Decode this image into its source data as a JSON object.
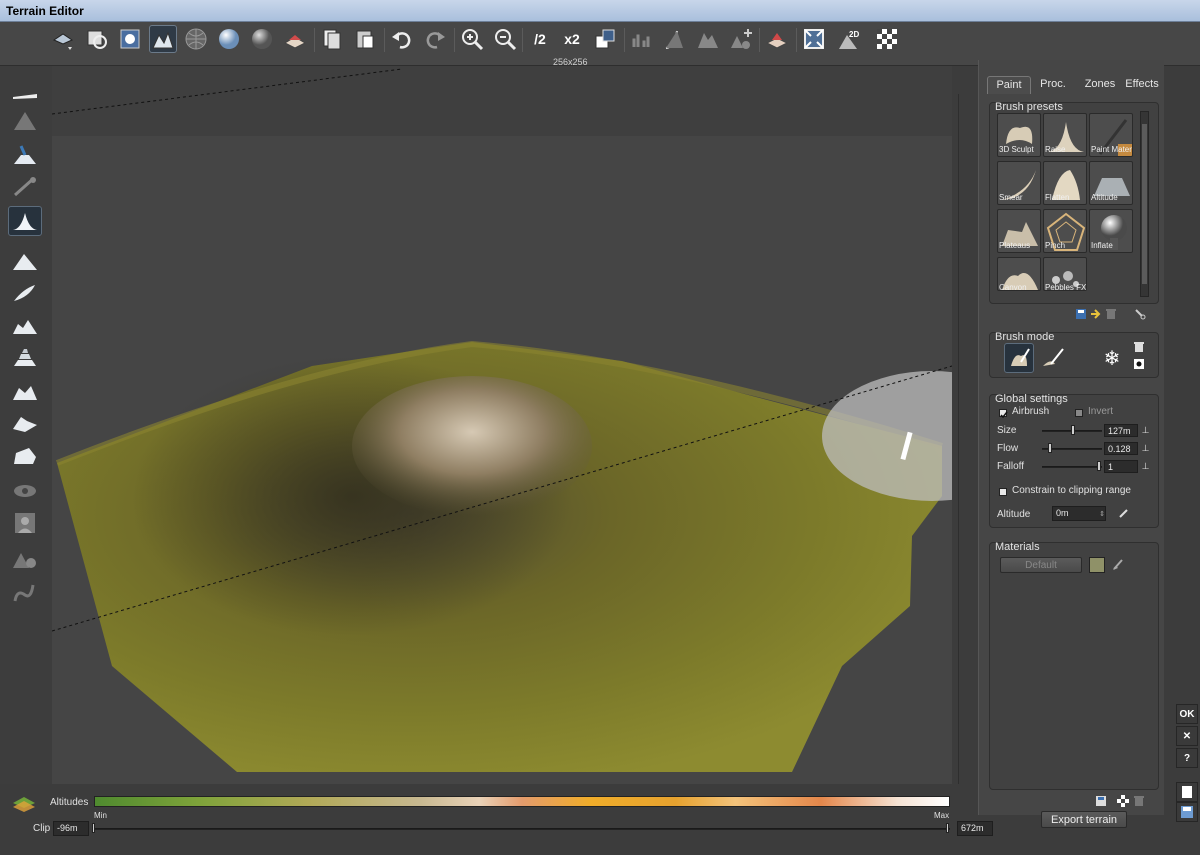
{
  "window": {
    "title": "Terrain Editor"
  },
  "toolbar": {
    "resolution_label": "256x256",
    "half_label": "/2",
    "double_label": "x2",
    "items": [
      "terrain-menu",
      "zoom-extents",
      "light-view",
      "textured-view",
      "wireframe-view",
      "sphere-shading",
      "material-shading",
      "flatten-view",
      "copy-terrain",
      "paste-terrain",
      "undo",
      "redo",
      "zoom-in",
      "zoom-out",
      "halve-resolution",
      "double-resolution",
      "crop",
      "histogram",
      "curve",
      "erosion",
      "add-feature",
      "displace",
      "fit-view",
      "2d-view",
      "transparency"
    ]
  },
  "left_tools": [
    "raise-tool",
    "mountain-tool",
    "plateau-tool",
    "brush-stroke-tool",
    "peak-tool",
    "hill-tool",
    "ridge-tool",
    "rocks-tool",
    "terrace-tool",
    "crater-tool",
    "dunes-tool",
    "cliff-tool",
    "eye-tool",
    "portrait-tool",
    "gear-terrain-tool",
    "path-tool"
  ],
  "panel": {
    "tabs": [
      "Paint",
      "Proc.",
      "Zones",
      "Effects"
    ],
    "active_tab": "Paint",
    "brush_presets": {
      "title": "Brush presets",
      "items": [
        "3D Sculpt",
        "Raise",
        "Paint Mater",
        "Smear",
        "Flatten",
        "Altitude",
        "Plateaus",
        "Pinch",
        "Inflate",
        "Canyon",
        "Pebbles FX"
      ]
    },
    "brush_mode": {
      "title": "Brush mode"
    },
    "global_settings": {
      "title": "Global settings",
      "airbrush_label": "Airbrush",
      "invert_label": "Invert",
      "size_label": "Size",
      "size_value": "127m",
      "size_level": 0.5,
      "flow_label": "Flow",
      "flow_value": "0.128",
      "flow_level": 0.13,
      "falloff_label": "Falloff",
      "falloff_value": "1",
      "falloff_level": 1.0,
      "clip_label": "Constrain to clipping range",
      "altitude_label": "Altitude",
      "altitude_value": "0m"
    },
    "materials": {
      "title": "Materials",
      "default_label": "Default",
      "swatch_color": "#8f9168"
    },
    "export_label": "Export terrain"
  },
  "right_strip": {
    "ok_label": "OK",
    "close_label": "✕",
    "help_label": "?"
  },
  "bottom": {
    "altitudes_label": "Altitudes",
    "min_label": "Min",
    "max_label": "Max",
    "clip_label": "Clip",
    "clip_min": "-96m",
    "clip_max": "672m"
  },
  "colors": {
    "accent": "#2f3a46",
    "terrain_base": "#7a7a2c",
    "terrain_peak": "#d8cdbb"
  }
}
